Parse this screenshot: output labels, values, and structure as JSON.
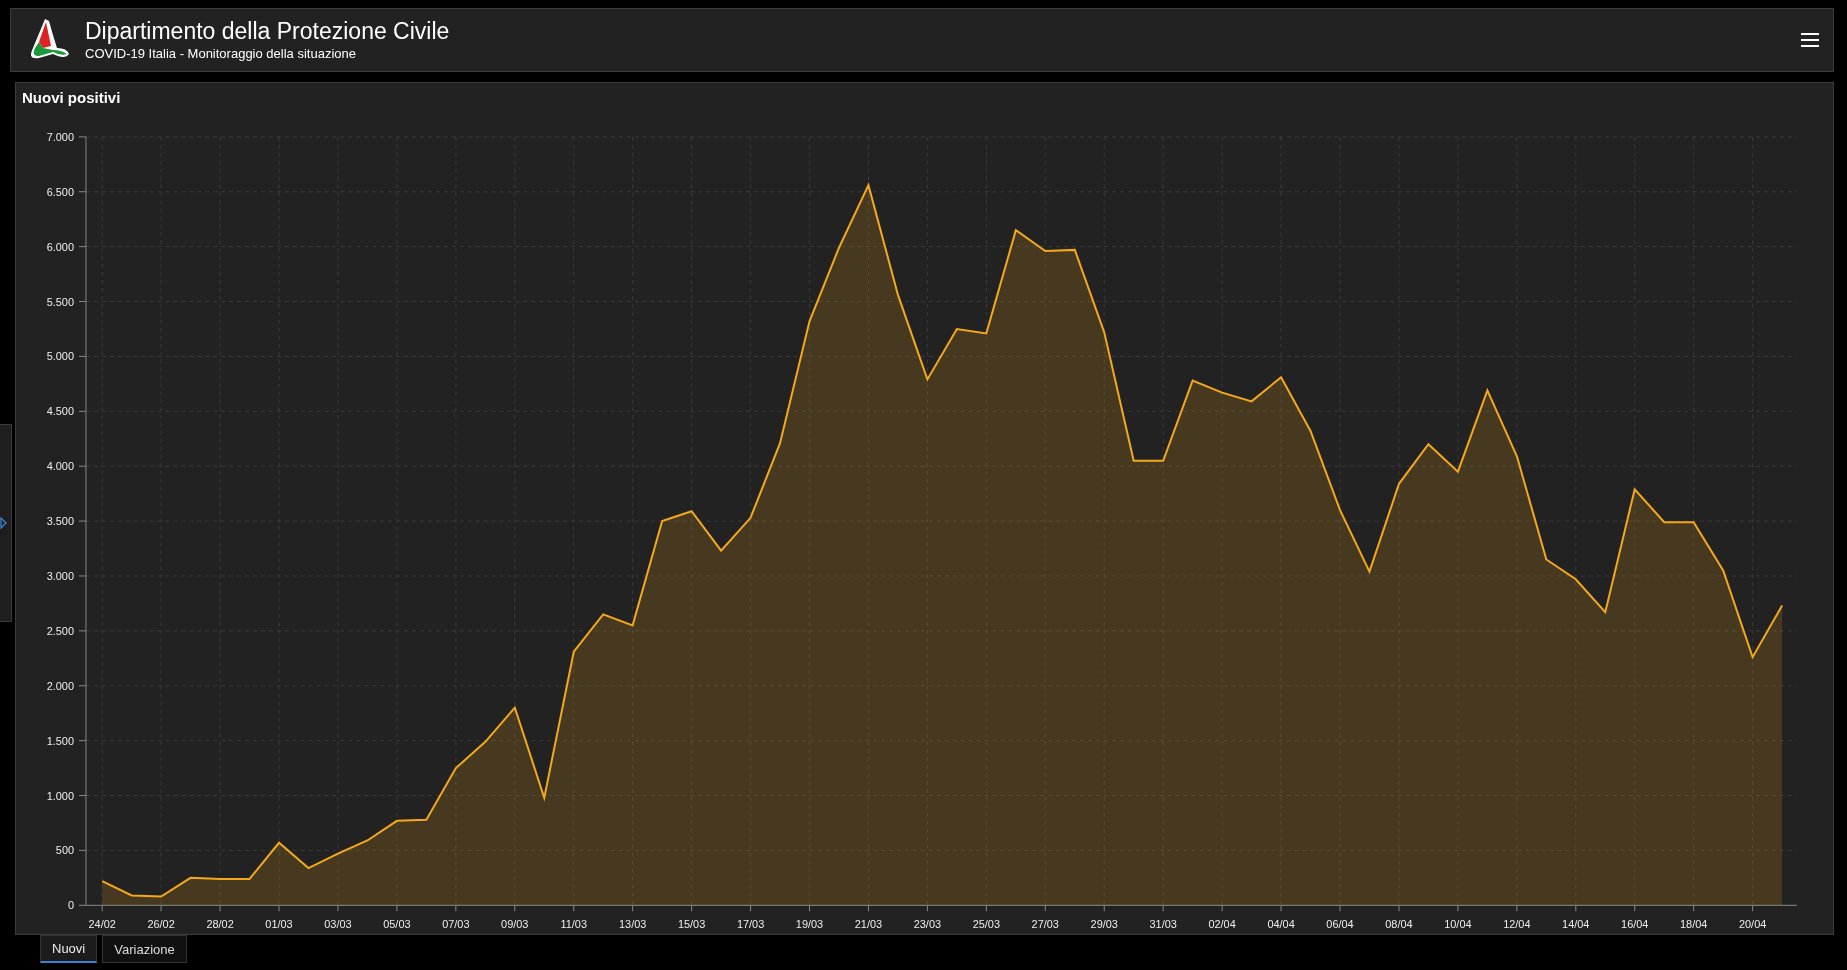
{
  "header": {
    "title": "Dipartimento della Protezione Civile",
    "subtitle": "COVID-19 Italia - Monitoraggio della situazione"
  },
  "panel": {
    "title": "Nuovi positivi",
    "chart_data": {
      "type": "area",
      "grid": true,
      "categories": [
        "24/02",
        null,
        "26/02",
        null,
        "28/02",
        null,
        "01/03",
        null,
        "03/03",
        null,
        "05/03",
        null,
        "07/03",
        null,
        "09/03",
        null,
        "11/03",
        null,
        "13/03",
        null,
        "15/03",
        null,
        "17/03",
        null,
        "19/03",
        null,
        "21/03",
        null,
        "23/03",
        null,
        "25/03",
        null,
        "27/03",
        null,
        "29/03",
        null,
        "31/03",
        null,
        "02/04",
        null,
        "04/04",
        null,
        "06/04",
        null,
        "08/04",
        null,
        "10/04",
        null,
        "12/04",
        null,
        "14/04",
        null,
        "16/04",
        null,
        "18/04",
        null,
        "20/04",
        null
      ],
      "series": [
        {
          "color": "#f5a81c",
          "values": [
            220,
            90,
            80,
            250,
            240,
            240,
            570,
            340,
            470,
            590,
            770,
            780,
            1250,
            1490,
            1800,
            980,
            2310,
            2650,
            2550,
            3500,
            3590,
            3230,
            3530,
            4210,
            5320,
            5990,
            6560,
            5560,
            4790,
            5250,
            5210,
            6150,
            5960,
            5970,
            5220,
            4050,
            4050,
            4780,
            4670,
            4590,
            4810,
            4320,
            3600,
            3040,
            3840,
            4200,
            3950,
            4690,
            4090,
            3150,
            2970,
            2670,
            3790,
            3490,
            3490,
            3050,
            2260,
            2730
          ]
        }
      ],
      "ylim": [
        0,
        7000
      ],
      "yticks": [
        {
          "value": 0,
          "label": "0"
        },
        {
          "value": 500,
          "label": "500"
        },
        {
          "value": 1000,
          "label": "1.000"
        },
        {
          "value": 1500,
          "label": "1.500"
        },
        {
          "value": 2000,
          "label": "2.000"
        },
        {
          "value": 2500,
          "label": "2.500"
        },
        {
          "value": 3000,
          "label": "3.000"
        },
        {
          "value": 3500,
          "label": "3.500"
        },
        {
          "value": 4000,
          "label": "4.000"
        },
        {
          "value": 4500,
          "label": "4.500"
        },
        {
          "value": 5000,
          "label": "5.000"
        },
        {
          "value": 5500,
          "label": "5.500"
        },
        {
          "value": 6000,
          "label": "6.000"
        },
        {
          "value": 6500,
          "label": "6.500"
        },
        {
          "value": 7000,
          "label": "7.000"
        }
      ]
    }
  },
  "tabs": [
    {
      "label": "Nuovi",
      "selected": true
    },
    {
      "label": "Variazione",
      "selected": false
    }
  ]
}
